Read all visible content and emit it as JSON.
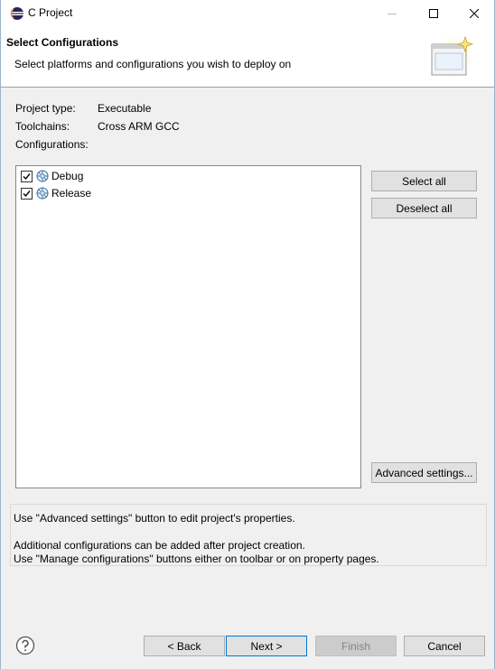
{
  "window": {
    "title": "C Project"
  },
  "banner": {
    "title": "Select Configurations",
    "description": "Select platforms and configurations you wish to deploy on"
  },
  "info": {
    "project_type_label": "Project type:",
    "project_type_value": "Executable",
    "toolchains_label": "Toolchains:",
    "toolchains_value": "Cross ARM GCC",
    "configurations_label": "Configurations:"
  },
  "configurations": [
    {
      "label": "Debug",
      "checked": true,
      "icon": "configuration-icon"
    },
    {
      "label": "Release",
      "checked": true,
      "icon": "configuration-icon"
    }
  ],
  "side_buttons": {
    "select_all": "Select all",
    "deselect_all": "Deselect all",
    "advanced_settings": "Advanced settings..."
  },
  "messages": {
    "line1": "Use \"Advanced settings\" button to edit project's properties.",
    "line2": "Additional configurations can be added after project creation.",
    "line3": "Use \"Manage configurations\" buttons either on toolbar or on property pages."
  },
  "footer": {
    "back": "< Back",
    "next": "Next >",
    "finish": "Finish",
    "cancel": "Cancel",
    "finish_enabled": false
  },
  "colors": {
    "accent": "#0078d7",
    "window_bg": "#f0f0f0",
    "disabled_button": "#cccccc"
  }
}
